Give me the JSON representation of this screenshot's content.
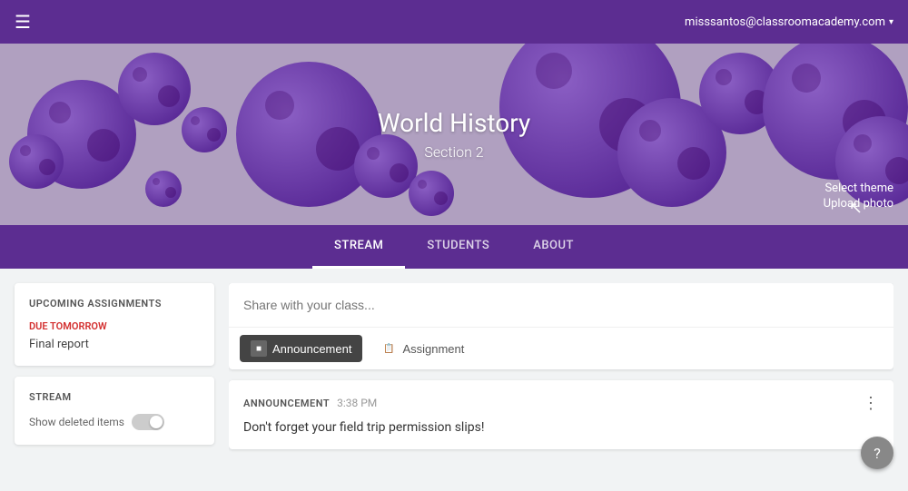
{
  "topBar": {
    "menuIcon": "☰",
    "userEmail": "misssantos@classroomacademy.com",
    "dropdownArrow": "▾"
  },
  "hero": {
    "title": "World History",
    "subtitle": "Section 2",
    "selectThemeLabel": "Select theme",
    "uploadPhotoLabel": "Upload photo"
  },
  "navTabs": [
    {
      "id": "stream",
      "label": "STREAM",
      "active": true
    },
    {
      "id": "students",
      "label": "STUDENTS",
      "active": false
    },
    {
      "id": "about",
      "label": "ABOUT",
      "active": false
    }
  ],
  "sidebar": {
    "upcomingTitle": "UPCOMING ASSIGNMENTS",
    "dueTomorrowLabel": "DUE TOMORROW",
    "assignmentItem": "Final report",
    "streamTitle": "STREAM",
    "showDeletedLabel": "Show deleted items"
  },
  "shareBox": {
    "placeholder": "Share with your class...",
    "buttons": [
      {
        "id": "announcement",
        "label": "Announcement",
        "icon": "■"
      },
      {
        "id": "assignment",
        "label": "Assignment",
        "icon": "📋"
      }
    ]
  },
  "announcement": {
    "label": "ANNOUNCEMENT",
    "time": "3:38 PM",
    "text": "Don't forget your field trip permission slips!",
    "moreIcon": "⋮"
  },
  "help": {
    "icon": "?"
  }
}
